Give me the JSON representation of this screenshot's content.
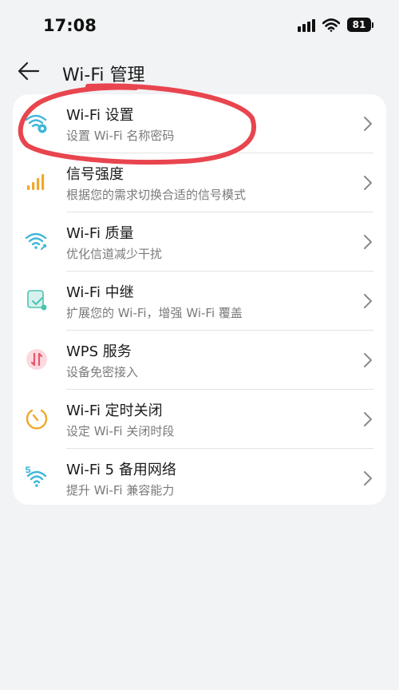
{
  "status_bar": {
    "time": "17:08",
    "battery": "81",
    "icons": [
      "signal-icon",
      "wifi-icon",
      "battery-icon"
    ]
  },
  "header": {
    "title": "Wi-Fi 管理",
    "back_icon": "arrow-left-icon"
  },
  "menu": {
    "items": [
      {
        "title": "Wi-Fi 设置",
        "subtitle": "设置 Wi-Fi 名称密码",
        "icon": "wifi-gear-icon",
        "color": "#3fb6d9"
      },
      {
        "title": "信号强度",
        "subtitle": "根据您的需求切换合适的信号模式",
        "icon": "signal-bars-icon",
        "color": "#f0a72b"
      },
      {
        "title": "Wi-Fi 质量",
        "subtitle": "优化信道减少干扰",
        "icon": "wifi-quality-icon",
        "color": "#3fb6d9"
      },
      {
        "title": "Wi-Fi 中继",
        "subtitle": "扩展您的 Wi-Fi，增强 Wi-Fi 覆盖",
        "icon": "relay-icon",
        "color": "#4cc3b0"
      },
      {
        "title": "WPS 服务",
        "subtitle": "设备免密接入",
        "icon": "wps-icon",
        "color": "#e8566b"
      },
      {
        "title": "Wi-Fi 定时关闭",
        "subtitle": "设定 Wi-Fi 关闭时段",
        "icon": "timer-icon",
        "color": "#f0a72b"
      },
      {
        "title": "Wi-Fi 5 备用网络",
        "subtitle": "提升 Wi-Fi 兼容能力",
        "icon": "wifi5-icon",
        "color": "#3fb6d9"
      }
    ]
  },
  "annotation_color": "#e8454f"
}
